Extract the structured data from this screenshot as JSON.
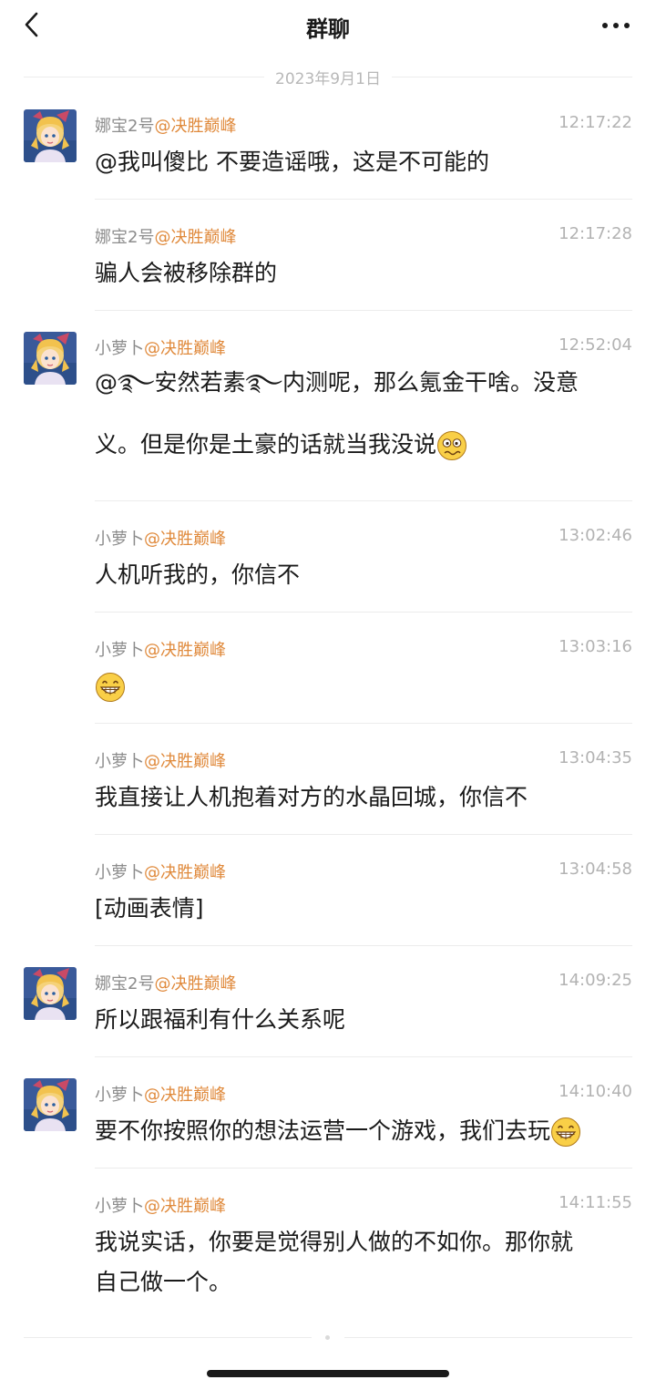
{
  "header": {
    "title": "群聊",
    "back_icon": "chevron-left-icon",
    "more_icon": "more-dots-icon"
  },
  "date_separator": "2023年9月1日",
  "colors": {
    "group_tag": "#e08a3c",
    "sender": "#8c8c8c",
    "time": "#b3b3b3",
    "text": "#1a1a1a",
    "divider": "#ececec"
  },
  "messages": [
    {
      "sender": "娜宝2号",
      "group": "@决胜巅峰",
      "time": "12:17:22",
      "text": "@我叫傻比 不要造谣哦，这是不可能的",
      "avatar": true
    },
    {
      "sender": "娜宝2号",
      "group": "@决胜巅峰",
      "time": "12:17:28",
      "text": "骗人会被移除群的",
      "avatar": false
    },
    {
      "sender": "小萝卜",
      "group": "@决胜巅峰",
      "time": "12:52:04",
      "text_line1": "@࿐安然若素࿐内测呢，那么氪金干啥。没意",
      "text_line2": "义。但是你是土豪的话就当我没说",
      "emoji": "dizzy-face-icon",
      "avatar": true
    },
    {
      "sender": "小萝卜",
      "group": "@决胜巅峰",
      "time": "13:02:46",
      "text": "人机听我的，你信不",
      "avatar": false
    },
    {
      "sender": "小萝卜",
      "group": "@决胜巅峰",
      "time": "13:03:16",
      "text": "",
      "emoji": "grinning-face-icon",
      "avatar": false
    },
    {
      "sender": "小萝卜",
      "group": "@决胜巅峰",
      "time": "13:04:35",
      "text": "我直接让人机抱着对方的水晶回城，你信不",
      "avatar": false
    },
    {
      "sender": "小萝卜",
      "group": "@决胜巅峰",
      "time": "13:04:58",
      "text": "[动画表情]",
      "avatar": false
    },
    {
      "sender": "娜宝2号",
      "group": "@决胜巅峰",
      "time": "14:09:25",
      "text": "所以跟福利有什么关系呢",
      "avatar": true
    },
    {
      "sender": "小萝卜",
      "group": "@决胜巅峰",
      "time": "14:10:40",
      "text": "要不你按照你的想法运营一个游戏，我们去玩",
      "emoji": "grinning-face-icon",
      "avatar": true
    },
    {
      "sender": "小萝卜",
      "group": "@决胜巅峰",
      "time": "14:11:55",
      "text_line1": "我说实话，你要是觉得别人做的不如你。那你就",
      "text_line2": "自己做一个。",
      "avatar": false
    }
  ]
}
